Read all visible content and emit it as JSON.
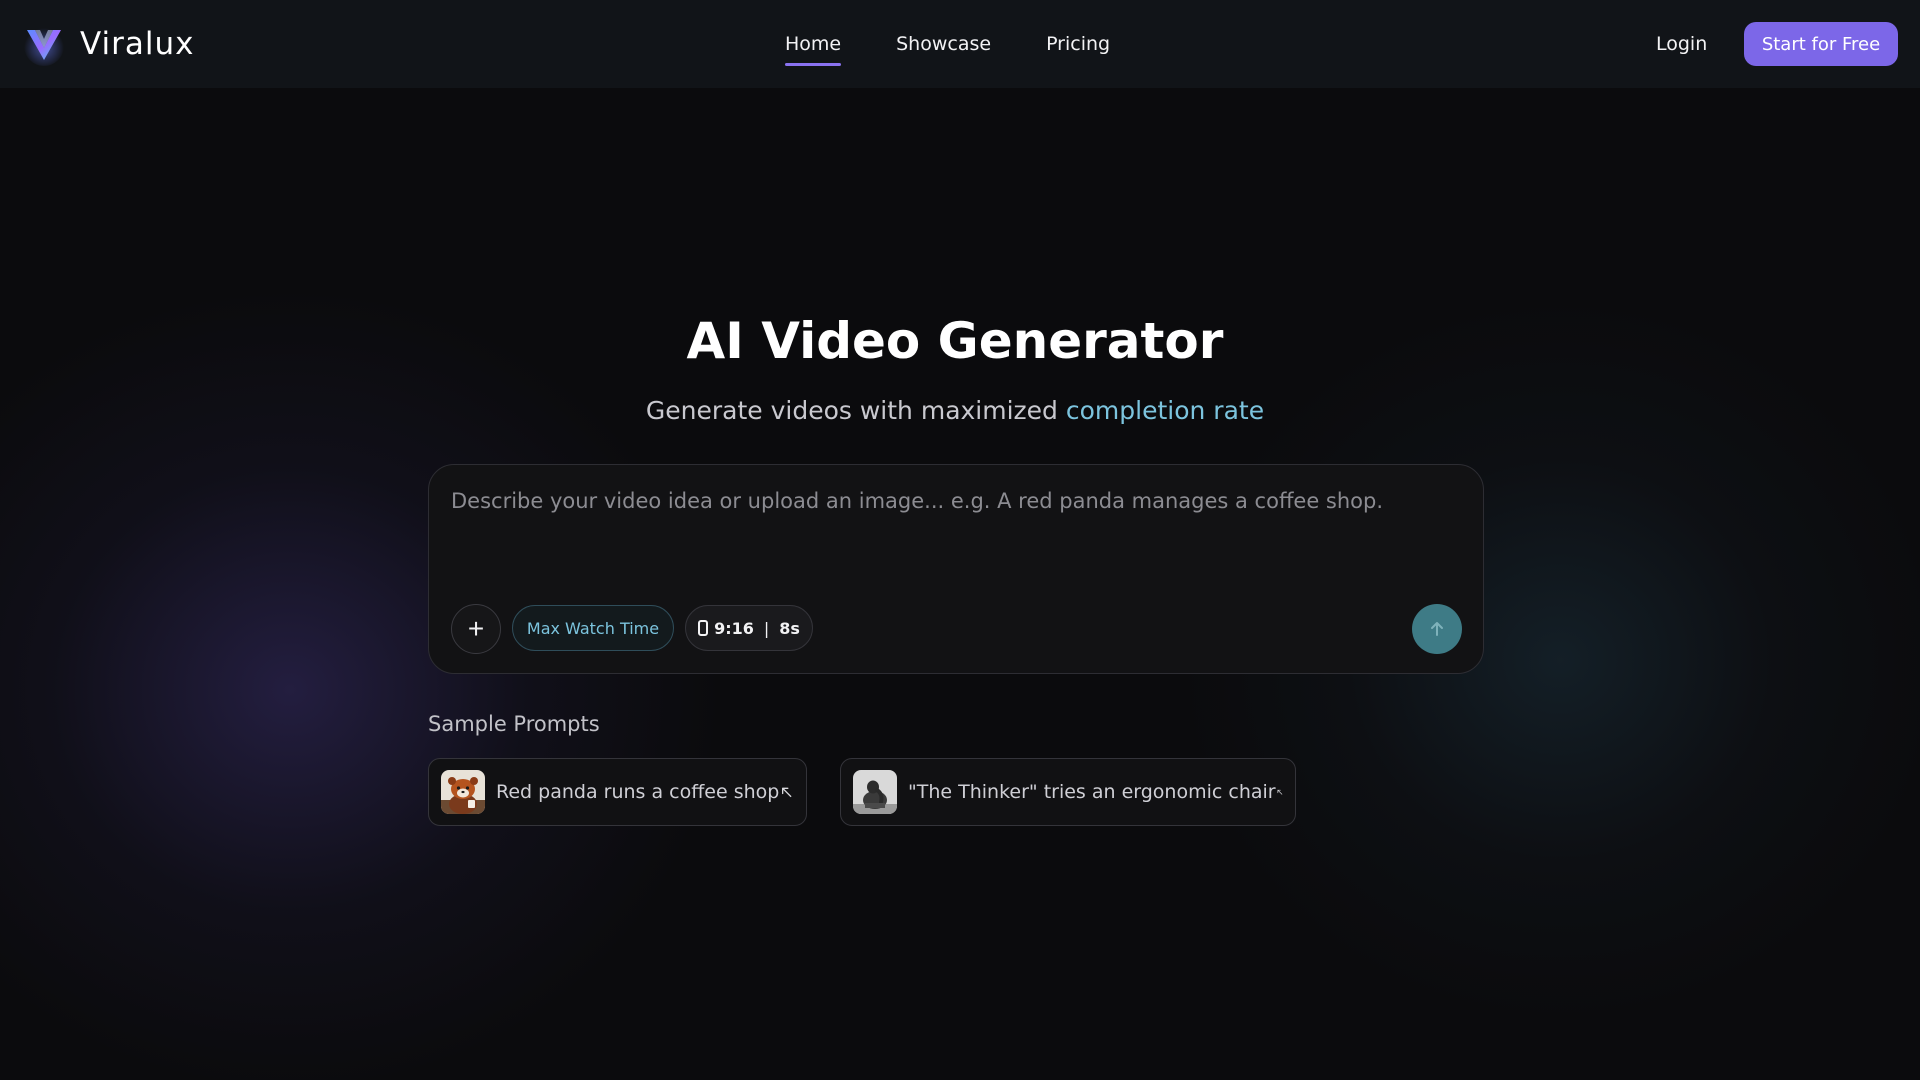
{
  "brand": {
    "name": "Viralux",
    "logo_icon": "v-logo-icon"
  },
  "nav": {
    "items": [
      {
        "label": "Home",
        "active": true
      },
      {
        "label": "Showcase",
        "active": false
      },
      {
        "label": "Pricing",
        "active": false
      }
    ],
    "login_label": "Login",
    "cta_label": "Start for Free"
  },
  "hero": {
    "title": "AI Video Generator",
    "subtitle_prefix": "Generate videos with maximized ",
    "subtitle_accent": "completion rate"
  },
  "prompt": {
    "value": "",
    "placeholder": "Describe your video idea or upload an image... e.g. A red panda manages a coffee shop.",
    "add_icon": "plus-icon",
    "mode_chip_label": "Max Watch Time",
    "aspect_ratio": "9:16",
    "duration": "8s",
    "send_icon": "arrow-up-icon"
  },
  "samples": {
    "heading": "Sample Prompts",
    "items": [
      {
        "label": "Red panda runs a coffee shop",
        "icon": "arrow-up-left-icon"
      },
      {
        "label": "\"The Thinker\" tries an ergonomic chair",
        "icon": "arrow-up-left-icon"
      }
    ]
  },
  "colors": {
    "accent_purple": "#7c67e8",
    "accent_cyan": "#7cc4de",
    "send_button": "#3e7b86",
    "navbar_bg": "#111418"
  }
}
